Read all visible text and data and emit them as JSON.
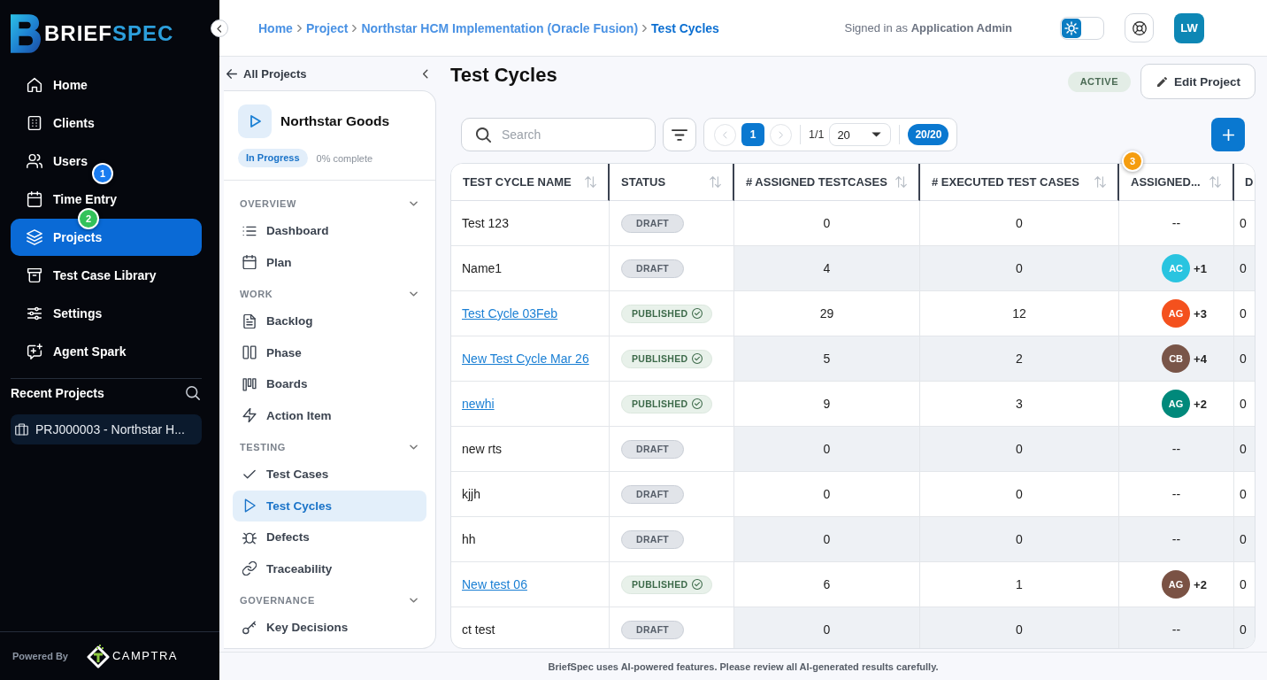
{
  "brand": {
    "name_part_1": "BRIEF",
    "name_part_2": "SPEC"
  },
  "sidebar": {
    "items": [
      {
        "label": "Home",
        "selected": false
      },
      {
        "label": "Clients",
        "selected": false
      },
      {
        "label": "Users",
        "selected": false
      },
      {
        "label": "Time Entry",
        "selected": false
      },
      {
        "label": "Projects",
        "selected": true
      },
      {
        "label": "Test Case Library",
        "selected": false
      },
      {
        "label": "Settings",
        "selected": false
      },
      {
        "label": "Agent Spark",
        "selected": false
      }
    ],
    "recent_projects": {
      "title": "Recent Projects",
      "items": [
        {
          "label": "PRJ000003 - Northstar H..."
        }
      ]
    },
    "powered_by": {
      "label": "Powered By",
      "company": "CAMPTRA"
    }
  },
  "tour_markers": [
    {
      "label": "1",
      "color": "#1a7cf0"
    },
    {
      "label": "2",
      "color": "#33c25a"
    },
    {
      "label": "3",
      "color": "#f59d0f"
    }
  ],
  "header": {
    "breadcrumb": [
      {
        "label": "Home",
        "current": false
      },
      {
        "label": "Project",
        "current": false
      },
      {
        "label": "Northstar HCM Implementation (Oracle Fusion)",
        "current": false
      },
      {
        "label": "Test Cycles",
        "current": true
      }
    ],
    "signed_in": "Signed in as **Application Admin**",
    "theme_toggle": {
      "on": false
    },
    "avatar": "LW"
  },
  "project_panel": {
    "back_label": "All Projects",
    "project_name": "Northstar Goods",
    "status": "In Progress",
    "progress": "0% complete",
    "sections": [
      {
        "title": "OVERVIEW",
        "expanded": true,
        "items": [
          {
            "label": "Dashboard",
            "selected": false
          },
          {
            "label": "Plan",
            "selected": false
          }
        ]
      },
      {
        "title": "WORK",
        "expanded": true,
        "items": [
          {
            "label": "Backlog",
            "selected": false
          },
          {
            "label": "Phase",
            "selected": false
          },
          {
            "label": "Boards",
            "selected": false
          },
          {
            "label": "Action Item",
            "selected": false
          }
        ]
      },
      {
        "title": "TESTING",
        "expanded": true,
        "items": [
          {
            "label": "Test Cases",
            "selected": false
          },
          {
            "label": "Test Cycles",
            "selected": true
          },
          {
            "label": "Defects",
            "selected": false
          },
          {
            "label": "Traceability",
            "selected": false
          }
        ]
      },
      {
        "title": "GOVERNANCE",
        "expanded": true,
        "items": [
          {
            "label": "Key Decisions",
            "selected": false
          }
        ]
      }
    ]
  },
  "page": {
    "title": "Test Cycles",
    "status": "ACTIVE",
    "edit_button": "Edit Project"
  },
  "toolbar": {
    "search": {
      "placeholder": "Search"
    },
    "pagination": {
      "previous": {
        "disabled": true
      },
      "pages": [
        {
          "label": "1",
          "selected": true
        }
      ],
      "next": {
        "disabled": true
      },
      "page_info": "1/1",
      "page_size": "20",
      "count": "20/20"
    }
  },
  "table": {
    "columns": [
      {
        "label": "TEST CYCLE NAME"
      },
      {
        "label": "STATUS"
      },
      {
        "label": "# ASSIGNED TESTCASES"
      },
      {
        "label": "# EXECUTED TEST CASES"
      },
      {
        "label": "ASSIGNED..."
      }
    ],
    "column_6_header": "D",
    "rows": [
      {
        "name": "Test 123",
        "link": false,
        "status": {
          "label": "DRAFT",
          "kind": "draft"
        },
        "assigned": "0",
        "executed": "0",
        "assignee": {
          "kind": "none",
          "text": "--"
        },
        "column_6": "0"
      },
      {
        "name": "Name1",
        "link": false,
        "status": {
          "label": "DRAFT",
          "kind": "draft"
        },
        "assigned": "4",
        "executed": "0",
        "assignee": {
          "kind": "avatar",
          "initials": "AC",
          "color": "#29c4e0",
          "extra": "+1"
        },
        "column_6": "0"
      },
      {
        "name": "Test Cycle 03Feb",
        "link": true,
        "status": {
          "label": "PUBLISHED",
          "kind": "published"
        },
        "assigned": "29",
        "executed": "12",
        "assignee": {
          "kind": "avatar",
          "initials": "AG",
          "color": "#f4511e",
          "extra": "+3"
        },
        "column_6": "0"
      },
      {
        "name": "New Test Cycle Mar 26",
        "link": true,
        "status": {
          "label": "PUBLISHED",
          "kind": "published"
        },
        "assigned": "5",
        "executed": "2",
        "assignee": {
          "kind": "avatar",
          "initials": "CB",
          "color": "#795548",
          "extra": "+4"
        },
        "column_6": "0"
      },
      {
        "name": "newhi",
        "link": true,
        "status": {
          "label": "PUBLISHED",
          "kind": "published"
        },
        "assigned": "9",
        "executed": "3",
        "assignee": {
          "kind": "avatar",
          "initials": "AG",
          "color": "#00897b",
          "extra": "+2"
        },
        "column_6": "0"
      },
      {
        "name": "new rts",
        "link": false,
        "status": {
          "label": "DRAFT",
          "kind": "draft"
        },
        "assigned": "0",
        "executed": "0",
        "assignee": {
          "kind": "none",
          "text": "--"
        },
        "column_6": "0"
      },
      {
        "name": "kjjh",
        "link": false,
        "status": {
          "label": "DRAFT",
          "kind": "draft"
        },
        "assigned": "0",
        "executed": "0",
        "assignee": {
          "kind": "none",
          "text": "--"
        },
        "column_6": "0"
      },
      {
        "name": "hh",
        "link": false,
        "status": {
          "label": "DRAFT",
          "kind": "draft"
        },
        "assigned": "0",
        "executed": "0",
        "assignee": {
          "kind": "none",
          "text": "--"
        },
        "column_6": "0"
      },
      {
        "name": "New test 06",
        "link": true,
        "status": {
          "label": "PUBLISHED",
          "kind": "published"
        },
        "assigned": "6",
        "executed": "1",
        "assignee": {
          "kind": "avatar",
          "initials": "AG",
          "color": "#7a5244",
          "extra": "+2"
        },
        "column_6": "0"
      },
      {
        "name": "ct test",
        "link": false,
        "status": {
          "label": "DRAFT",
          "kind": "draft"
        },
        "assigned": "0",
        "executed": "0",
        "assignee": {
          "kind": "none",
          "text": "--"
        },
        "column_6": "0"
      }
    ]
  },
  "footer": {
    "notice": "BriefSpec uses AI-powered features. Please review all AI-generated results carefully."
  }
}
